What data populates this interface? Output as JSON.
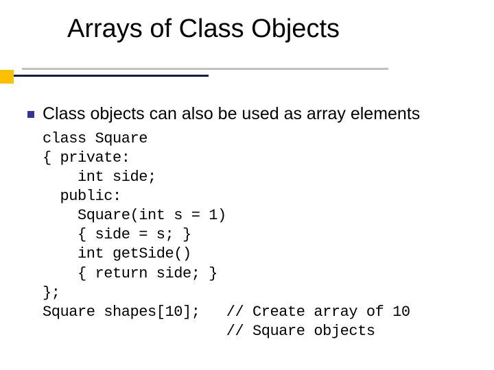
{
  "title": "Arrays of Class Objects",
  "bullets": [
    {
      "text": "Class objects can also be used as array elements"
    }
  ],
  "code": "class Square\n{ private:\n    int side;\n  public:\n    Square(int s = 1)\n    { side = s; }\n    int getSide()\n    { return side; }\n};\nSquare shapes[10];   // Create array of 10\n                     // Square objects"
}
